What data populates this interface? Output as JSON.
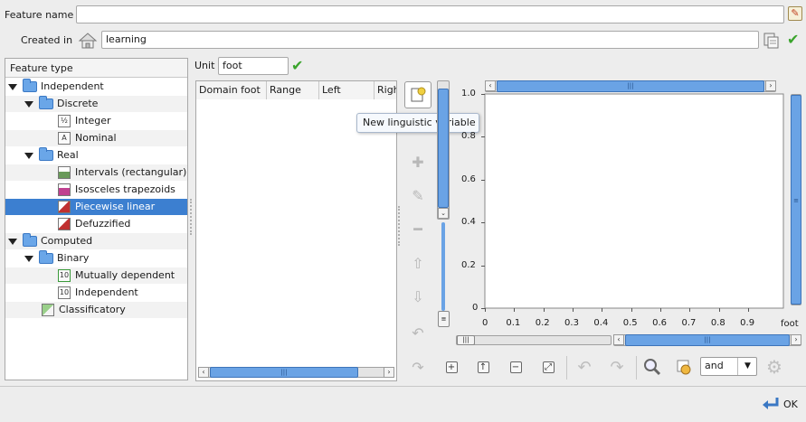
{
  "feature": {
    "name_label": "Feature name",
    "name_value": "",
    "created_label": "Created in",
    "created_value": "learning"
  },
  "tree": {
    "header": "Feature type",
    "items": [
      {
        "label": "Independent"
      },
      {
        "label": "Discrete"
      },
      {
        "label": "Integer",
        "icon": "½"
      },
      {
        "label": "Nominal",
        "icon": "A"
      },
      {
        "label": "Real"
      },
      {
        "label": "Intervals (rectangular)"
      },
      {
        "label": "Isosceles trapezoids"
      },
      {
        "label": "Piecewise linear"
      },
      {
        "label": "Defuzzified"
      },
      {
        "label": "Computed"
      },
      {
        "label": "Binary"
      },
      {
        "label": "Mutually dependent",
        "icon": "10"
      },
      {
        "label": "Independent",
        "icon": "10"
      },
      {
        "label": "Classificatory"
      }
    ]
  },
  "unit": {
    "label": "Unit",
    "value": "foot"
  },
  "table": {
    "columns": [
      "Domain foot",
      "Range",
      "Left",
      "Righ"
    ]
  },
  "tooltip": "New linguistic variable",
  "plot": {
    "y_ticks": [
      "1.0",
      "0.8",
      "0.6",
      "0.4",
      "0.2",
      "0"
    ],
    "x_ticks": [
      "0",
      "0.1",
      "0.2",
      "0.3",
      "0.4",
      "0.5",
      "0.6",
      "0.7",
      "0.8",
      "0.9"
    ],
    "x_unit": "foot",
    "x_range": [
      0,
      1
    ],
    "y_range": [
      0,
      1
    ]
  },
  "combine": {
    "value": "and"
  },
  "ok_label": "OK",
  "icons": {
    "edit": "pencil-icon",
    "home": "home-icon",
    "browse": "browse-icon",
    "check": "check-icon"
  }
}
